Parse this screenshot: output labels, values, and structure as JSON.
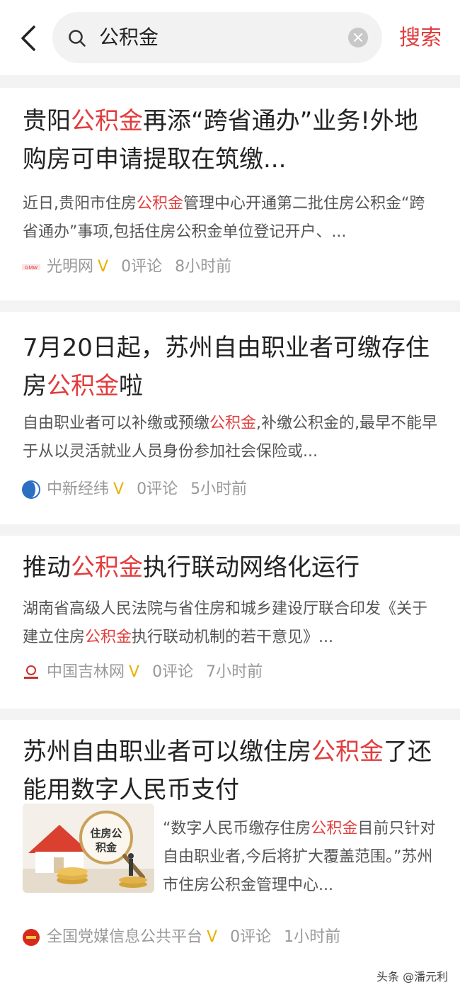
{
  "search": {
    "query": "公积金",
    "button": "搜索"
  },
  "articles": [
    {
      "title_parts": [
        "贵阳",
        "公积金",
        "再添“跨省通办”业务!外地购房可申请提取在筑缴..."
      ],
      "summary_parts": [
        "近日,贵阳市住房",
        "公积金",
        "管理中心开通第二批住房公积金“跨省通办”事项,包括住房公积金单位登记开户、..."
      ],
      "source": "光明网",
      "comments": "0评论",
      "time": "8小时前"
    },
    {
      "title_parts": [
        "7月20日起，苏州自由职业者可缴存住房",
        "公积金",
        "啦"
      ],
      "summary_parts": [
        "自由职业者可以补缴或预缴",
        "公积金",
        ",补缴公积金的,最早不能早于从以灵活就业人员身份参加社会保险或..."
      ],
      "source": "中新经纬",
      "comments": "0评论",
      "time": "5小时前"
    },
    {
      "title_parts": [
        "推动",
        "公积金",
        "执行联动网络化运行"
      ],
      "summary_parts": [
        "湖南省高级人民法院与省住房和城乡建设厅联合印发《关于建立住房",
        "公积金",
        "执行联动机制的若干意见》..."
      ],
      "source": "中国吉林网",
      "comments": "0评论",
      "time": "7小时前"
    },
    {
      "title_parts": [
        "苏州自由职业者可以缴住房",
        "公积金",
        "了还能用数字人民币支付"
      ],
      "summary_parts": [
        "“数字人民币缴存住房",
        "公积金",
        "目前只针对自由职业者,今后将扩大覆盖范围。”苏州市住房公积金管理中心..."
      ],
      "thumb_text": "住房公积金",
      "source": "全国党媒信息公共平台",
      "comments": "0评论",
      "time": "1小时前"
    }
  ],
  "verified_mark": "V",
  "watermark": "头条 @潘元利",
  "colors": {
    "accent": "#e23d3d",
    "verified": "#e8b100",
    "divider": "#f3f3f3"
  }
}
